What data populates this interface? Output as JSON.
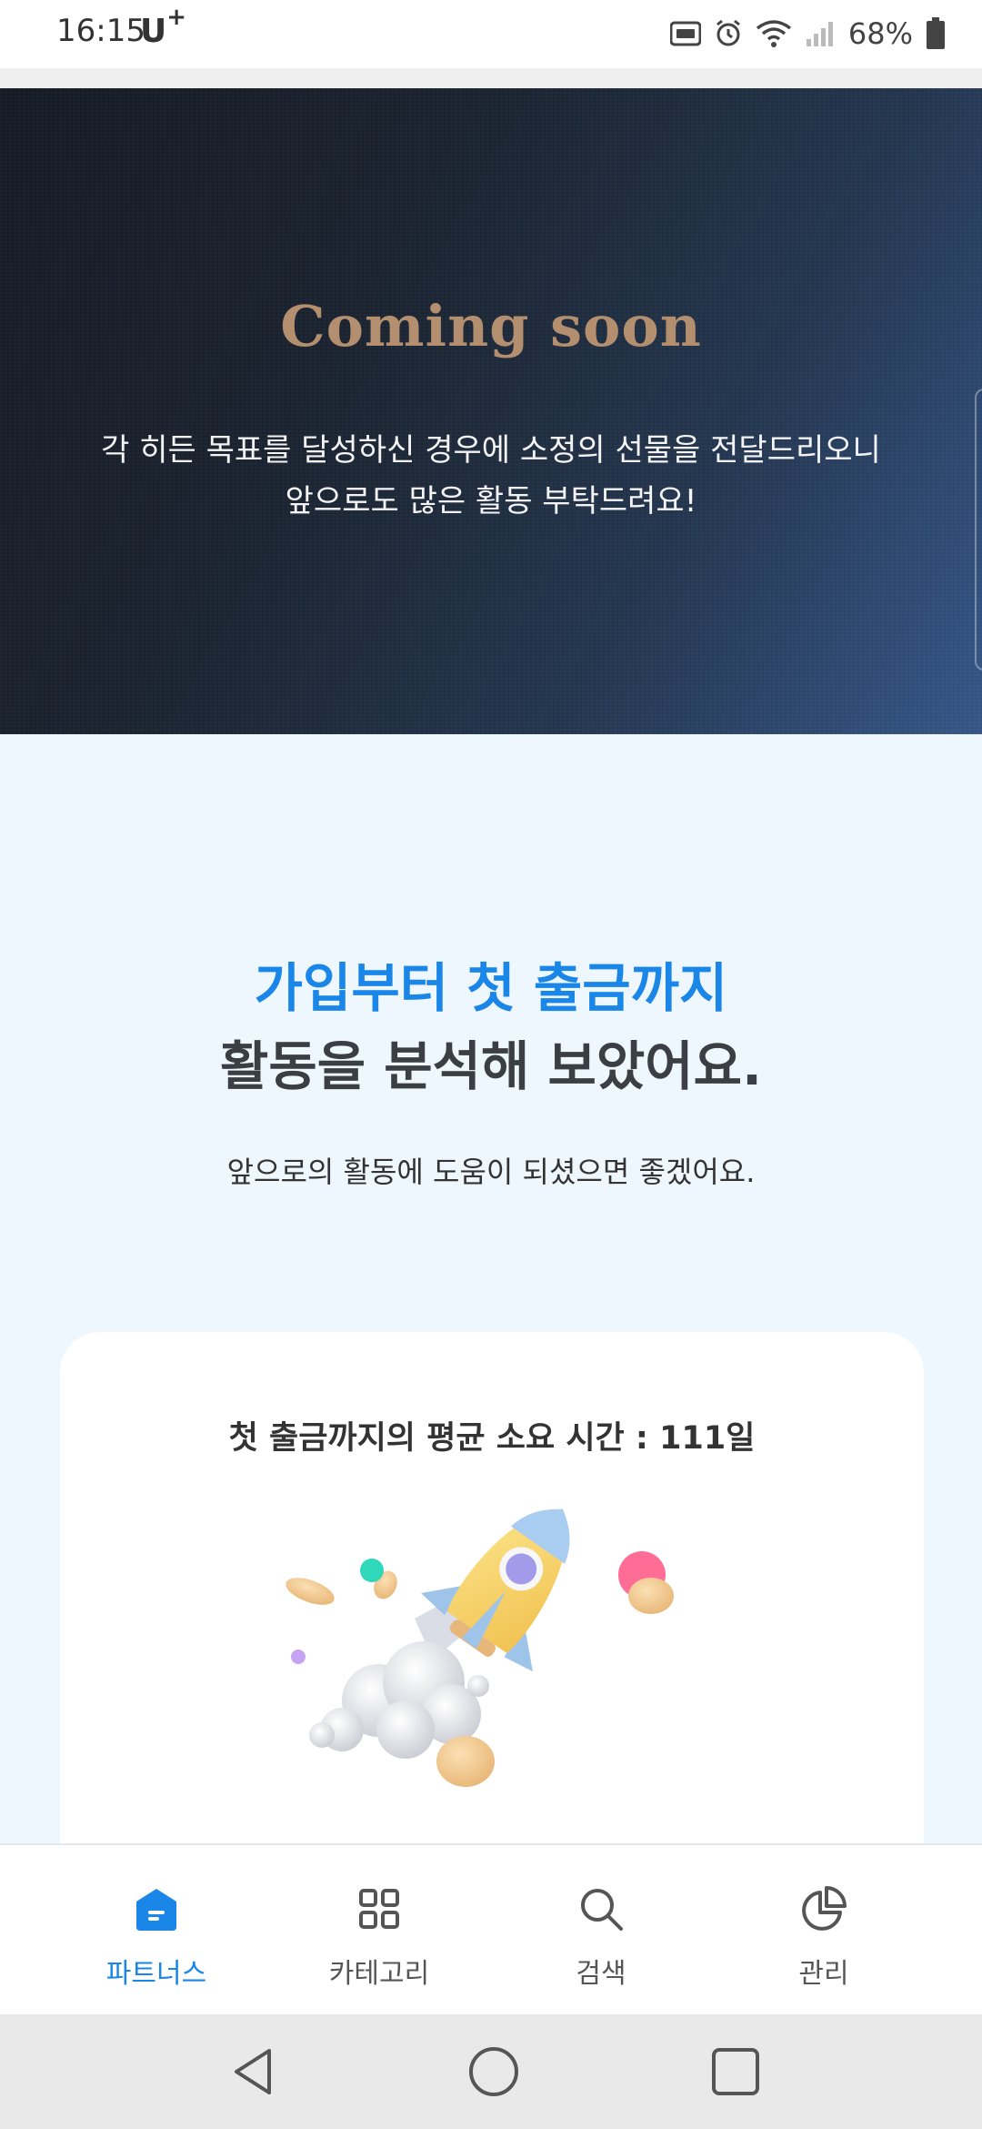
{
  "status_bar": {
    "time": "16:15",
    "carrier": "U",
    "carrier_sup": "+",
    "battery_percent": "68%",
    "icons": [
      "nfc-icon",
      "alarm-icon",
      "wifi-icon",
      "signal-icon",
      "battery-icon"
    ]
  },
  "hero": {
    "title": "Coming soon",
    "text_line1": "각 히든 목표를 달성하신 경우에 소정의 선물을 전달드리오니",
    "text_line2": "앞으로도 많은 활동 부탁드려요!"
  },
  "analysis": {
    "title_line1": "가입부터 첫 출금까지",
    "title_line2": "활동을 분석해 보았어요.",
    "subtitle": "앞으로의 활동에 도움이 되셨으면 좋겠어요.",
    "card_title": "첫 출금까지의 평균 소요 시간 : 111일"
  },
  "bottom_nav": {
    "items": [
      {
        "label": "파트너스",
        "icon": "home-icon",
        "active": true
      },
      {
        "label": "카테고리",
        "icon": "grid-icon",
        "active": false
      },
      {
        "label": "검색",
        "icon": "search-icon",
        "active": false
      },
      {
        "label": "관리",
        "icon": "pie-chart-icon",
        "active": false
      }
    ]
  },
  "system_nav": {
    "icons": [
      "back-icon",
      "home-circle-icon",
      "recents-icon"
    ]
  },
  "colors": {
    "accent": "#1a86e8",
    "hero_title": "#b48f6f",
    "section_bg": "#eef6fe",
    "heading_dark": "#3b3f45"
  }
}
